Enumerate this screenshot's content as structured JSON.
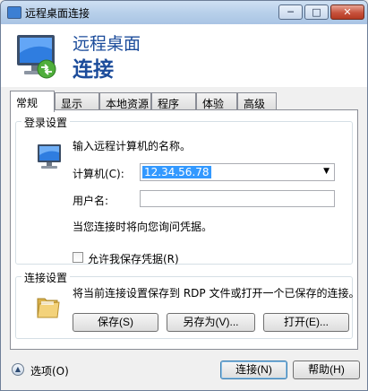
{
  "window": {
    "title": "远程桌面连接",
    "controls": {
      "minimize": "─",
      "maximize": "□",
      "close": "✕"
    }
  },
  "banner": {
    "line1": "远程桌面",
    "line2": "连接"
  },
  "tabs": [
    {
      "label": "常规",
      "active": true
    },
    {
      "label": "显示"
    },
    {
      "label": "本地资源"
    },
    {
      "label": "程序"
    },
    {
      "label": "体验"
    },
    {
      "label": "高级"
    }
  ],
  "login": {
    "group_title": "登录设置",
    "prompt": "输入远程计算机的名称。",
    "computer_label": "计算机(C):",
    "computer_value": "12.34.56.78",
    "username_label": "用户名:",
    "username_value": "",
    "hint": "当您连接时将向您询问凭据。",
    "save_credentials_label": "允许我保存凭据(R)",
    "save_credentials_checked": false
  },
  "connection": {
    "group_title": "连接设置",
    "description": "将当前连接设置保存到 RDP 文件或打开一个已保存的连接。",
    "save_label": "保存(S)",
    "save_as_label": "另存为(V)...",
    "open_label": "打开(E)..."
  },
  "footer": {
    "options_label": "选项(O)",
    "connect_label": "连接(N)",
    "help_label": "帮助(H)"
  },
  "icons": {
    "app": "remote-desktop-icon",
    "computer": "computer-icon",
    "folder": "folder-icon",
    "expand": "chevron-up-icon"
  },
  "colors": {
    "banner_text": "#1c4c9b",
    "selection": "#3399ff"
  }
}
